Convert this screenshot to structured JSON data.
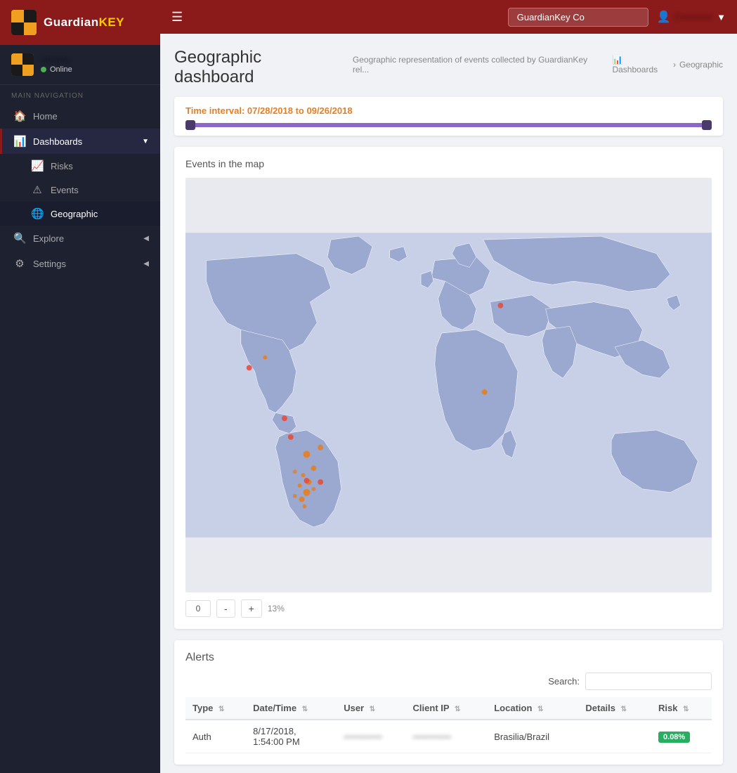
{
  "app": {
    "name": "Guardian",
    "name_highlight": "KEY",
    "logo_alt": "GuardianKEY Logo"
  },
  "sidebar": {
    "user": {
      "name": "P••••••••",
      "status": "Online"
    },
    "nav_label": "MAIN NAVIGATION",
    "items": [
      {
        "id": "home",
        "label": "Home",
        "icon": "🏠",
        "active": false
      },
      {
        "id": "dashboards",
        "label": "Dashboards",
        "icon": "📊",
        "active": true,
        "expanded": true
      },
      {
        "id": "risks",
        "label": "Risks",
        "icon": "📈",
        "active": false,
        "sub": true
      },
      {
        "id": "events",
        "label": "Events",
        "icon": "⚠",
        "active": false,
        "sub": true
      },
      {
        "id": "geographic",
        "label": "Geographic",
        "icon": "🌐",
        "active": true,
        "sub": true
      },
      {
        "id": "explore",
        "label": "Explore",
        "icon": "🔍",
        "active": false,
        "has_arrow": true
      },
      {
        "id": "settings",
        "label": "Settings",
        "icon": "⚙",
        "active": false,
        "has_arrow": true
      }
    ]
  },
  "topbar": {
    "search_placeholder": "GuardianKey Co",
    "search_value": "GuardianKey Co",
    "user_label": "F••••••••••",
    "hamburger_icon": "☰"
  },
  "breadcrumb": {
    "items": [
      "Dashboards",
      "Geographic"
    ]
  },
  "page": {
    "title": "Geographic dashboard",
    "subtitle": "Geographic representation of events collected by GuardianKey rel...",
    "time_interval_label": "Time interval:",
    "time_interval_value": "07/28/2018 to 09/26/2018"
  },
  "map": {
    "section_title": "Events in the map",
    "zoom_value": "0",
    "zoom_pct": "13%",
    "btn_minus": "-",
    "btn_plus": "+"
  },
  "alerts": {
    "title": "Alerts",
    "search_label": "Search:",
    "search_placeholder": "",
    "columns": [
      "Type",
      "Date/Time",
      "User",
      "Client IP",
      "Location",
      "Details",
      "Risk"
    ],
    "rows": [
      {
        "type": "Auth",
        "datetime": "8/17/2018, 1:54:00 PM",
        "user": "••••••••••",
        "client_ip": "••••••••••••",
        "location": "Brasilia/Brazil",
        "details": "",
        "risk": "0.08%"
      }
    ]
  }
}
